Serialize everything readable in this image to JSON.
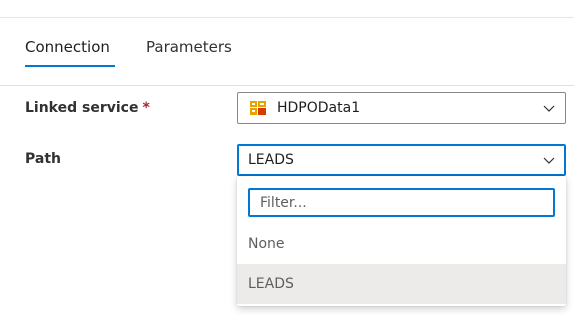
{
  "tabs": [
    {
      "label": "Connection",
      "active": true
    },
    {
      "label": "Parameters",
      "active": false
    }
  ],
  "form": {
    "linked_service": {
      "label": "Linked service",
      "required_mark": "*",
      "value": "HDPOData1",
      "icon": "odata-service-icon"
    },
    "path": {
      "label": "Path",
      "value": "LEADS",
      "dropdown": {
        "filter_placeholder": "Filter...",
        "filter_value": "",
        "options": [
          "None",
          "LEADS"
        ],
        "highlighted": "LEADS"
      }
    }
  },
  "colors": {
    "accent": "#0078d4",
    "required": "#a4262c",
    "service_icon": "#e8a200",
    "highlight": "#edebe9"
  }
}
